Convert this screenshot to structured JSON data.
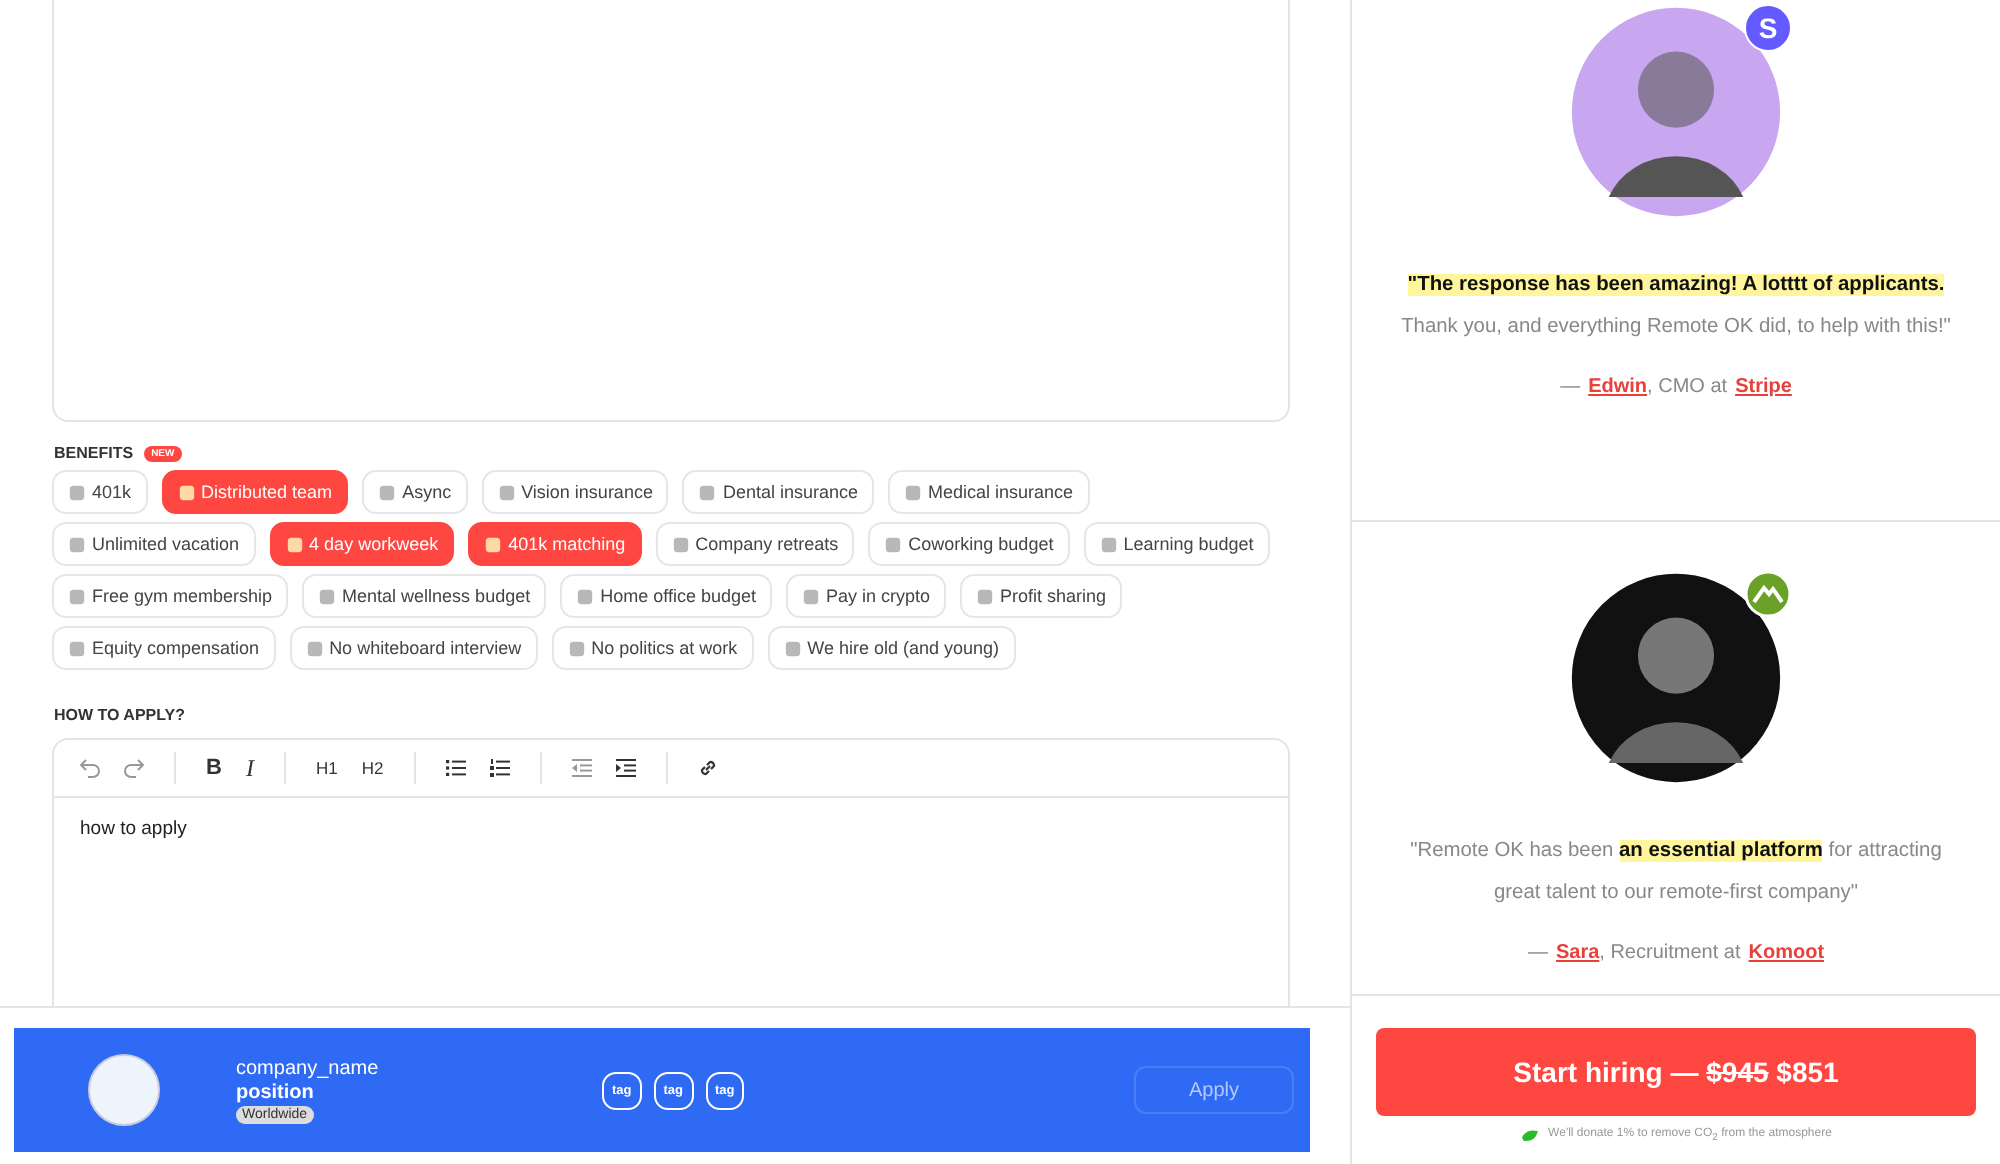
{
  "benefits": {
    "label": "BENEFITS",
    "badge": "NEW",
    "items": [
      {
        "label": "401k",
        "selected": false
      },
      {
        "label": "Distributed team",
        "selected": true
      },
      {
        "label": "Async",
        "selected": false
      },
      {
        "label": "Vision insurance",
        "selected": false
      },
      {
        "label": "Dental insurance",
        "selected": false
      },
      {
        "label": "Medical insurance",
        "selected": false
      },
      {
        "label": "Unlimited vacation",
        "selected": false
      },
      {
        "label": "4 day workweek",
        "selected": true
      },
      {
        "label": "401k matching",
        "selected": true
      },
      {
        "label": "Company retreats",
        "selected": false
      },
      {
        "label": "Coworking budget",
        "selected": false
      },
      {
        "label": "Learning budget",
        "selected": false
      },
      {
        "label": "Free gym membership",
        "selected": false
      },
      {
        "label": "Mental wellness budget",
        "selected": false
      },
      {
        "label": "Home office budget",
        "selected": false
      },
      {
        "label": "Pay in crypto",
        "selected": false
      },
      {
        "label": "Profit sharing",
        "selected": false
      },
      {
        "label": "Equity compensation",
        "selected": false
      },
      {
        "label": "No whiteboard interview",
        "selected": false
      },
      {
        "label": "No politics at work",
        "selected": false
      },
      {
        "label": "We hire old (and young)",
        "selected": false
      }
    ]
  },
  "how_to_apply": {
    "label": "HOW TO APPLY?",
    "toolbar": [
      {
        "kind": "undo"
      },
      {
        "kind": "redo"
      },
      {
        "kind": "sep"
      },
      {
        "kind": "bold",
        "text": "B"
      },
      {
        "kind": "italic",
        "text": "I"
      },
      {
        "kind": "sep"
      },
      {
        "kind": "heading",
        "text": "H1"
      },
      {
        "kind": "heading",
        "text": "H2"
      },
      {
        "kind": "sep"
      },
      {
        "kind": "bullets"
      },
      {
        "kind": "numbers"
      },
      {
        "kind": "sep"
      },
      {
        "kind": "outdent"
      },
      {
        "kind": "indent"
      },
      {
        "kind": "sep"
      },
      {
        "kind": "link"
      }
    ],
    "value": "how to apply"
  },
  "preview": {
    "company_name": "company_name",
    "position": "position",
    "location": "Worldwide",
    "tags": [
      "tag",
      "tag",
      "tag"
    ],
    "apply": {
      "label": "Apply",
      "disabled": true
    }
  },
  "testimonials": [
    {
      "badge": {
        "kind": "letter",
        "text": "S",
        "color": "#635bff"
      },
      "quote": "**\"The response has been amazing! A lotttt of applicants.** Thank you, and everything Remote OK did, to help with this!\"",
      "dash": "—",
      "name": "Edwin",
      "role": ", CMO at",
      "company": "Stripe"
    },
    {
      "badge": {
        "kind": "mountain",
        "color": "#6aa127"
      },
      "quote": "\"Remote OK has been **an essential platform** for attracting great talent to our remote-first company\"",
      "dash": "—",
      "name": "Sara",
      "role": ", Recruitment at",
      "company": "Komoot"
    }
  ],
  "cta": {
    "label": "Start hiring —",
    "old_price": "$945",
    "price": "$851",
    "note": "We'll donate 1% to remove CO$_{2}$ from the atmosphere"
  }
}
